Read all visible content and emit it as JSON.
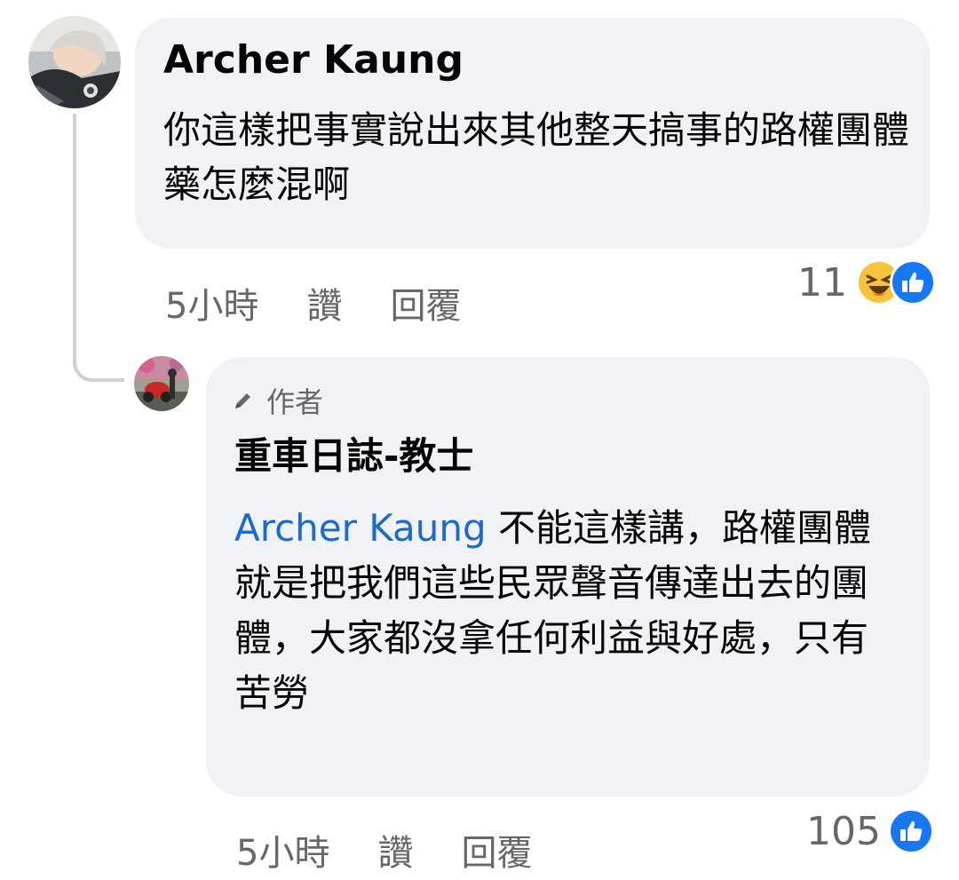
{
  "colors": {
    "bubble_bg": "#f0f2f5",
    "meta_text": "#65676b",
    "mention": "#1a6bcb",
    "like_blue": "#1877f2",
    "haha_yellow": "#f7c33a"
  },
  "comment1": {
    "author": "Archer Kaung",
    "text": "你這樣把事實說出來其他整天搞事的路權團體藥怎麼混啊",
    "time": "5小時",
    "like_label": "讚",
    "reply_label": "回覆",
    "reaction_count": "11",
    "reaction_icons": [
      "haha-icon",
      "like-icon"
    ]
  },
  "comment2": {
    "badge_label": "作者",
    "badge_icon": "pencil-icon",
    "author": "重車日誌-教士",
    "mention": "Archer Kaung",
    "text": " 不能這樣講，路權團體就是把我們這些民眾聲音傳達出去的團體，大家都沒拿任何利益與好處，只有苦勞",
    "time": "5小時",
    "like_label": "讚",
    "reply_label": "回覆",
    "reaction_count": "105",
    "reaction_icons": [
      "like-icon"
    ]
  }
}
